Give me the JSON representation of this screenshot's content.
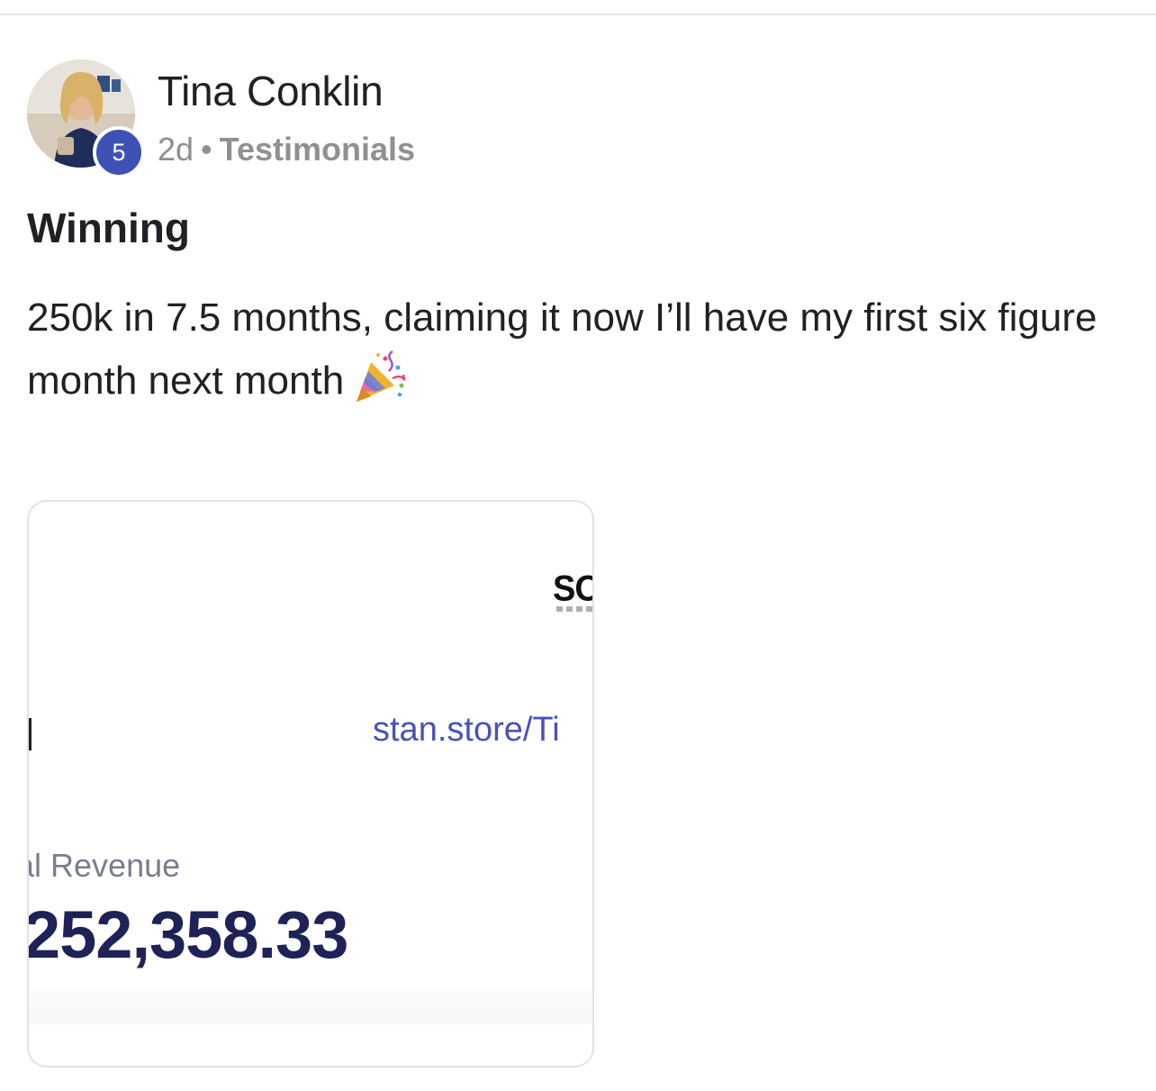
{
  "post": {
    "author": {
      "name": "Tina Conklin",
      "level": "5",
      "avatar_icon": "user-photo-avatar"
    },
    "meta": {
      "time": "2d",
      "separator": "•",
      "category": "Testimonials"
    },
    "title": "Winning",
    "body": "250k in 7.5 months, claiming it now I’ll have my first six figure month next month",
    "body_emoji": "party-popper-icon",
    "attachment": {
      "logo_text": "SO",
      "link_text": "stan.store/Ti",
      "label": "al Revenue",
      "amount": "252,358.33"
    }
  },
  "colors": {
    "badge": "#3f51b5",
    "link": "#4a52b8",
    "amount": "#1e2257",
    "meta": "#909090"
  }
}
